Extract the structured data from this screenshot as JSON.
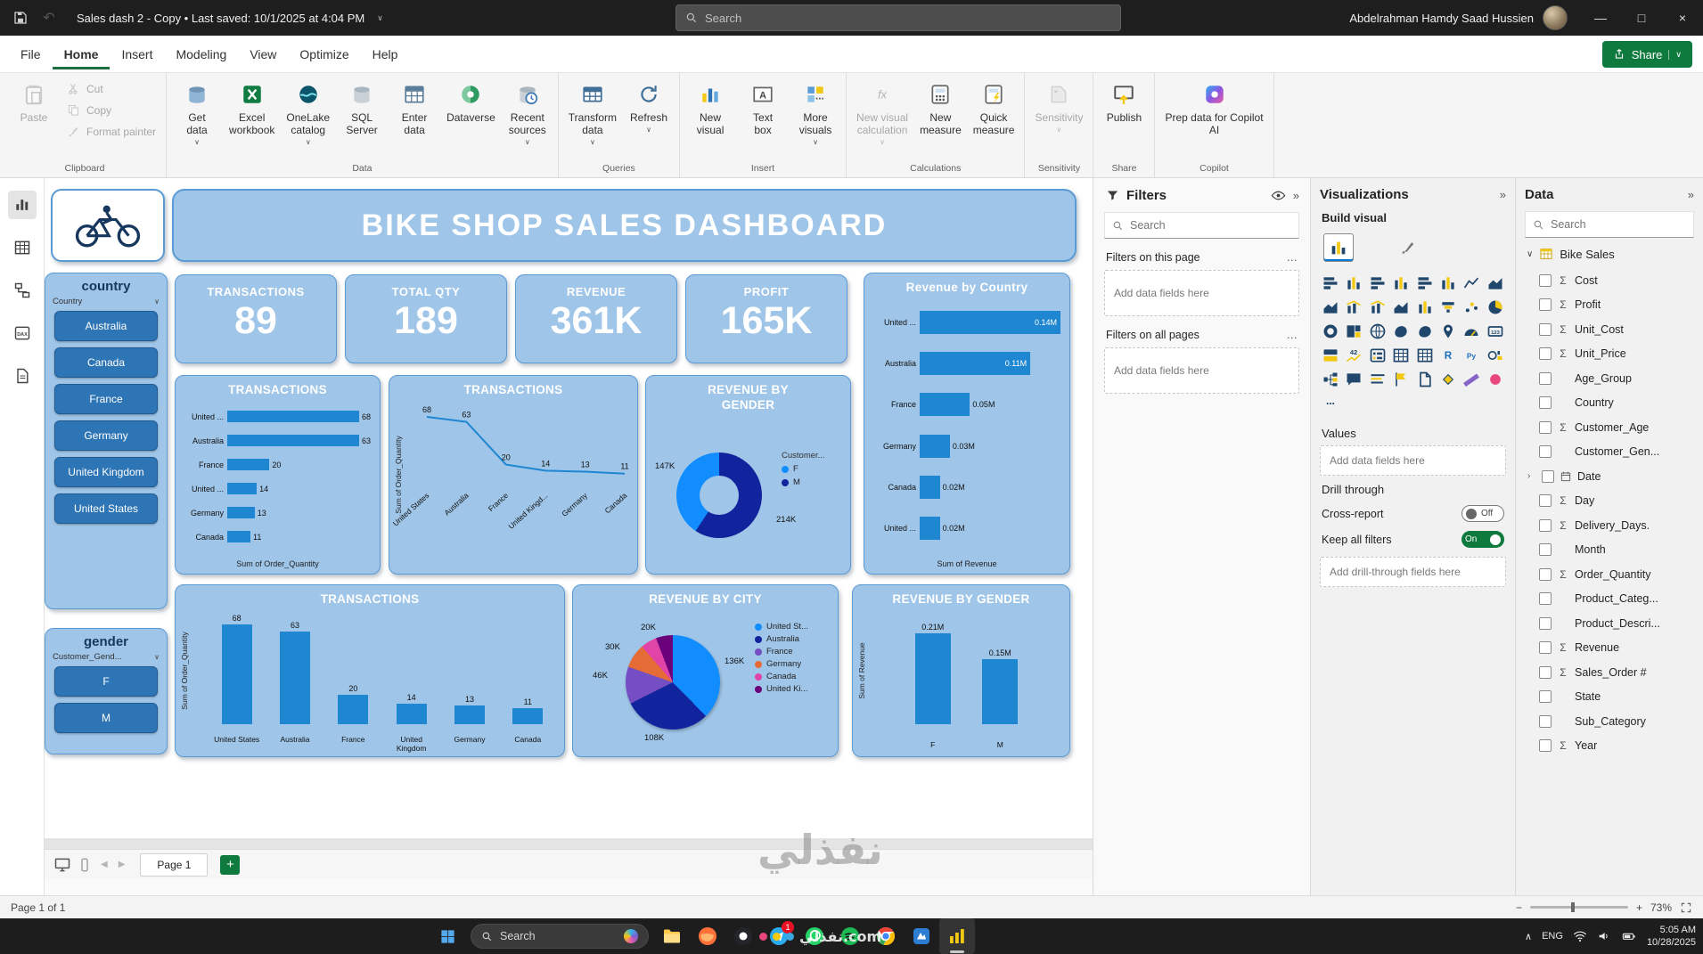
{
  "icons": {
    "caret-down": "∨",
    "collapse-right": "»",
    "more": "…",
    "chevron-left": "◀",
    "chevron-right": "▶",
    "chevron-up": "∧",
    "chevron-expand": "›",
    "sigma": "Σ",
    "minus": "−",
    "plus": "+",
    "minimize": "—",
    "maximize": "□",
    "close": "×",
    "undo": "↶"
  },
  "window": {
    "title": "Sales dash 2 - Copy • Last saved: 10/1/2025 at 4:04 PM",
    "search_placeholder": "Search",
    "user_name": "Abdelrahman Hamdy Saad Hussien"
  },
  "menubar": {
    "tabs": [
      {
        "label": "File"
      },
      {
        "label": "Home",
        "active": true
      },
      {
        "label": "Insert"
      },
      {
        "label": "Modeling"
      },
      {
        "label": "View"
      },
      {
        "label": "Optimize"
      },
      {
        "label": "Help"
      }
    ],
    "share_label": "Share"
  },
  "ribbon": {
    "groups": [
      {
        "label": "Clipboard",
        "items": [
          {
            "label": "Paste",
            "icon": "paste-icon",
            "disabled": true
          },
          {
            "label": "Cut",
            "icon": "cut-icon",
            "disabled": true
          },
          {
            "label": "Copy",
            "icon": "copy-icon",
            "disabled": true
          },
          {
            "label": "Format painter",
            "icon": "format-painter-icon",
            "disabled": true
          }
        ]
      },
      {
        "label": "Data",
        "items": [
          {
            "label": "Get\ndata",
            "icon": "get-data-icon",
            "caret": true
          },
          {
            "label": "Excel\nworkbook",
            "icon": "excel-workbook-icon"
          },
          {
            "label": "OneLake\ncatalog",
            "icon": "onelake-catalog-icon",
            "caret": true
          },
          {
            "label": "SQL\nServer",
            "icon": "sql-server-icon"
          },
          {
            "label": "Enter\ndata",
            "icon": "enter-data-icon"
          },
          {
            "label": "Dataverse",
            "icon": "dataverse-icon"
          },
          {
            "label": "Recent\nsources",
            "icon": "recent-sources-icon",
            "caret": true
          }
        ]
      },
      {
        "label": "Queries",
        "items": [
          {
            "label": "Transform\ndata",
            "icon": "transform-data-icon",
            "caret": true
          },
          {
            "label": "Refresh",
            "icon": "refresh-icon",
            "caret": true
          }
        ]
      },
      {
        "label": "Insert",
        "items": [
          {
            "label": "New\nvisual",
            "icon": "new-visual-icon"
          },
          {
            "label": "Text\nbox",
            "icon": "text-box-icon"
          },
          {
            "label": "More\nvisuals",
            "icon": "more-visuals-icon",
            "caret": true
          }
        ]
      },
      {
        "label": "Calculations",
        "items": [
          {
            "label": "New visual\ncalculation",
            "icon": "visual-calculation-icon",
            "disabled": true,
            "caret": true
          },
          {
            "label": "New\nmeasure",
            "icon": "new-measure-icon"
          },
          {
            "label": "Quick\nmeasure",
            "icon": "quick-measure-icon"
          }
        ]
      },
      {
        "label": "Sensitivity",
        "items": [
          {
            "label": "Sensitivity",
            "icon": "sensitivity-icon",
            "disabled": true,
            "caret": true
          }
        ]
      },
      {
        "label": "Share",
        "items": [
          {
            "label": "Publish",
            "icon": "publish-icon"
          }
        ]
      },
      {
        "label": "Copilot",
        "items": [
          {
            "label": "Prep data for Copilot\nAI",
            "icon": "copilot-icon"
          }
        ]
      }
    ]
  },
  "nav": {
    "items": [
      {
        "name": "report-view",
        "active": true
      },
      {
        "name": "table-view"
      },
      {
        "name": "model-view"
      },
      {
        "name": "dax-query-view"
      },
      {
        "name": "tmdl-view"
      }
    ]
  },
  "canvas": {
    "watermark": "نفذلي",
    "header": {
      "title": "BIKE  SHOP SALES DASHBOARD"
    },
    "country_slicer": {
      "title": "country",
      "field": "Country",
      "items": [
        "Australia",
        "Canada",
        "France",
        "Germany",
        "United Kingdom",
        "United States"
      ]
    },
    "gender_slicer": {
      "title": "gender",
      "field": "Customer_Gend...",
      "items": [
        "F",
        "M"
      ]
    },
    "kpis": [
      {
        "label": "TRANSACTIONS",
        "value": "89"
      },
      {
        "label": "TOTAL QTY",
        "value": "189"
      },
      {
        "label": "REVENUE",
        "value": "361K"
      },
      {
        "label": "PROFIT",
        "value": "165K"
      }
    ],
    "charts": {
      "revenue_by_country": {
        "type": "bar",
        "title": "Revenue by Country",
        "categories": [
          "United ...",
          "Australia",
          "France",
          "Germany",
          "Canada",
          "United ..."
        ],
        "values": [
          0.14,
          0.11,
          0.05,
          0.03,
          0.02,
          0.02
        ],
        "labels": [
          "0.14M",
          "0.11M",
          "0.05M",
          "0.03M",
          "0.02M",
          "0.02M"
        ],
        "xlabel": "Sum of Revenue"
      },
      "transactions_hbar": {
        "type": "bar",
        "title": "TRANSACTIONS",
        "categories": [
          "United ...",
          "Australia",
          "France",
          "United ...",
          "Germany",
          "Canada"
        ],
        "values": [
          68,
          63,
          20,
          14,
          13,
          11
        ],
        "xlabel": "Sum of Order_Quantity"
      },
      "transactions_line": {
        "type": "line",
        "title": "TRANSACTIONS",
        "categories": [
          "United States",
          "Australia",
          "France",
          "United Kingd...",
          "Germany",
          "Canada"
        ],
        "values": [
          68,
          63,
          20,
          14,
          13,
          11
        ],
        "ylabel": "Sum of Order_Quantity"
      },
      "revenue_by_gender_donut": {
        "type": "donut",
        "title": "REVENUE BY GENDER",
        "legend_title": "Customer...",
        "slices": [
          {
            "label": "F",
            "value": 147,
            "text": "147K",
            "color": "#118DFF"
          },
          {
            "label": "M",
            "value": 214,
            "text": "214K",
            "color": "#12239E"
          }
        ]
      },
      "transactions_column": {
        "type": "column",
        "title": "TRANSACTIONS",
        "categories": [
          "United States",
          "Australia",
          "France",
          "United Kingdom",
          "Germany",
          "Canada"
        ],
        "values": [
          68,
          63,
          20,
          14,
          13,
          11
        ],
        "ylabel": "Sum of Order_Quantity"
      },
      "revenue_by_city_pie": {
        "type": "pie",
        "title": "REVENUE BY CITY",
        "slices": [
          {
            "label": "United St...",
            "value": 136,
            "text": "136K",
            "color": "#118DFF"
          },
          {
            "label": "Australia",
            "value": 108,
            "text": "108K",
            "color": "#12239E"
          },
          {
            "label": "France",
            "value": 46,
            "text": "46K",
            "color": "#744EC2"
          },
          {
            "label": "Germany",
            "value": 30,
            "text": "30K",
            "color": "#E66C37"
          },
          {
            "label": "Canada",
            "value": 20,
            "text": "20K",
            "color": "#E044A7"
          },
          {
            "label": "United Ki...",
            "value": 21,
            "text": "",
            "color": "#6B007B"
          }
        ]
      },
      "revenue_by_gender_col": {
        "type": "column",
        "title": "REVENUE BY GENDER",
        "categories": [
          "F",
          "M"
        ],
        "values": [
          0.21,
          0.15
        ],
        "labels": [
          "0.21M",
          "0.15M"
        ],
        "ylabel": "Sum of Revenue"
      }
    }
  },
  "filters_pane": {
    "title": "Filters",
    "search_placeholder": "Search",
    "sections": [
      {
        "label": "Filters on this page",
        "placeholder": "Add data fields here"
      },
      {
        "label": "Filters on all pages",
        "placeholder": "Add data fields here"
      }
    ]
  },
  "viz_pane": {
    "title": "Visualizations",
    "build_label": "Build visual",
    "values_label": "Values",
    "values_placeholder": "Add data fields here",
    "drill_label": "Drill through",
    "cross_report": {
      "label": "Cross-report",
      "state": "Off"
    },
    "keep_filters": {
      "label": "Keep all filters",
      "state": "On"
    },
    "drill_placeholder": "Add drill-through fields here",
    "visual_icons": [
      {
        "name": "stacked-bar-chart-icon",
        "kind": "hbars"
      },
      {
        "name": "stacked-column-chart-icon",
        "kind": "vbars"
      },
      {
        "name": "clustered-bar-chart-icon",
        "kind": "hbars"
      },
      {
        "name": "clustered-column-chart-icon",
        "kind": "vbars"
      },
      {
        "name": "100-stacked-bar-chart-icon",
        "kind": "hbars"
      },
      {
        "name": "100-stacked-column-chart-icon",
        "kind": "vbars"
      },
      {
        "name": "line-chart-icon",
        "kind": "line"
      },
      {
        "name": "area-chart-icon",
        "kind": "area"
      },
      {
        "name": "stacked-area-chart-icon",
        "kind": "area"
      },
      {
        "name": "line-and-stacked-column-chart-icon",
        "kind": "combo"
      },
      {
        "name": "line-and-clustered-column-chart-icon",
        "kind": "combo"
      },
      {
        "name": "ribbon-chart-icon",
        "kind": "area"
      },
      {
        "name": "waterfall-chart-icon",
        "kind": "vbars"
      },
      {
        "name": "funnel-chart-icon",
        "kind": "funnel"
      },
      {
        "name": "scatter-chart-icon",
        "kind": "dots"
      },
      {
        "name": "pie-chart-icon",
        "kind": "pie"
      },
      {
        "name": "donut-chart-icon",
        "kind": "donut"
      },
      {
        "name": "treemap-icon",
        "kind": "treemap"
      },
      {
        "name": "map-icon",
        "kind": "globe"
      },
      {
        "name": "filled-map-icon",
        "kind": "blob"
      },
      {
        "name": "shape-map-icon",
        "kind": "blob"
      },
      {
        "name": "azure-map-icon",
        "kind": "pin"
      },
      {
        "name": "gauge-icon",
        "kind": "gauge"
      },
      {
        "name": "card-icon",
        "kind": "card123"
      },
      {
        "name": "multi-row-card-icon",
        "kind": "rows"
      },
      {
        "name": "kpi-icon",
        "kind": "kpi"
      },
      {
        "name": "slicer-icon",
        "kind": "slicer"
      },
      {
        "name": "table-icon",
        "kind": "grid"
      },
      {
        "name": "matrix-icon",
        "kind": "grid"
      },
      {
        "name": "r-script-icon",
        "kind": "rtext"
      },
      {
        "name": "python-visual-icon",
        "kind": "pytext"
      },
      {
        "name": "key-influencers-icon",
        "kind": "key"
      },
      {
        "name": "decomposition-tree-icon",
        "kind": "tree"
      },
      {
        "name": "qa-icon",
        "kind": "bubble"
      },
      {
        "name": "narrative-icon",
        "kind": "narrative"
      },
      {
        "name": "metrics-icon",
        "kind": "flag"
      },
      {
        "name": "paginated-report-icon",
        "kind": "doc"
      },
      {
        "name": "power-apps-icon",
        "kind": "diamond"
      },
      {
        "name": "power-automate-icon",
        "kind": "ruler"
      },
      {
        "name": "arcgis-map-icon",
        "kind": "dotred"
      },
      {
        "name": "more-visual-options-icon",
        "kind": "ellipsis"
      }
    ]
  },
  "data_pane": {
    "title": "Data",
    "search_placeholder": "Search",
    "table": {
      "name": "Bike Sales"
    },
    "fields": [
      {
        "name": "Cost",
        "numeric": true
      },
      {
        "name": "Profit",
        "numeric": true
      },
      {
        "name": "Unit_Cost",
        "numeric": true
      },
      {
        "name": "Unit_Price",
        "numeric": true
      },
      {
        "name": "Age_Group",
        "numeric": false
      },
      {
        "name": "Country",
        "numeric": false
      },
      {
        "name": "Customer_Age",
        "numeric": true
      },
      {
        "name": "Customer_Gen...",
        "numeric": false
      },
      {
        "name": "Date",
        "numeric": false,
        "date": true,
        "expandable": true
      },
      {
        "name": "Day",
        "numeric": true
      },
      {
        "name": "Delivery_Days.",
        "numeric": true
      },
      {
        "name": "Month",
        "numeric": false
      },
      {
        "name": "Order_Quantity",
        "numeric": true
      },
      {
        "name": "Product_Categ...",
        "numeric": false
      },
      {
        "name": "Product_Descri...",
        "numeric": false
      },
      {
        "name": "Revenue",
        "numeric": true
      },
      {
        "name": "Sales_Order #",
        "numeric": true
      },
      {
        "name": "State",
        "numeric": false
      },
      {
        "name": "Sub_Category",
        "numeric": false
      },
      {
        "name": "Year",
        "numeric": true
      }
    ]
  },
  "pagesbar": {
    "page_tab": "Page 1"
  },
  "statusbar": {
    "status": "Page 1 of 1",
    "zoom": "73%"
  },
  "taskbar": {
    "search_label": "Search",
    "apps": [
      {
        "name": "file-explorer"
      },
      {
        "name": "browser"
      },
      {
        "name": "media-app"
      },
      {
        "name": "telegram",
        "badge": "1"
      },
      {
        "name": "whatsapp"
      },
      {
        "name": "spotify"
      },
      {
        "name": "chrome"
      },
      {
        "name": "blue-app"
      },
      {
        "name": "power-bi",
        "active": true
      }
    ],
    "tray": {
      "lang": "ENG",
      "time": "5:05 AM",
      "date": "10/28/2025"
    },
    "watermark": "نفذلي.com"
  }
}
